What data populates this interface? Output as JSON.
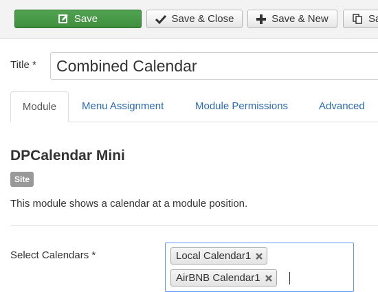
{
  "toolbar": {
    "save_label": "Save",
    "save_close_label": "Save & Close",
    "save_new_label": "Save & New",
    "copy_label": "Save as Copy",
    "save_color": "#4a9a4a"
  },
  "form": {
    "title_label": "Title *",
    "title_value": "Combined Calendar"
  },
  "tabs": [
    {
      "label": "Module",
      "active": true
    },
    {
      "label": "Menu Assignment",
      "active": false
    },
    {
      "label": "Module Permissions",
      "active": false
    },
    {
      "label": "Advanced",
      "active": false
    }
  ],
  "module": {
    "name": "DPCalendar Mini",
    "badge": "Site",
    "description": "This module shows a calendar at a module position."
  },
  "calendars": {
    "label": "Select Calendars *",
    "selected": [
      {
        "label": "Local Calendar1"
      },
      {
        "label": "AirBNB Calendar1"
      }
    ]
  }
}
